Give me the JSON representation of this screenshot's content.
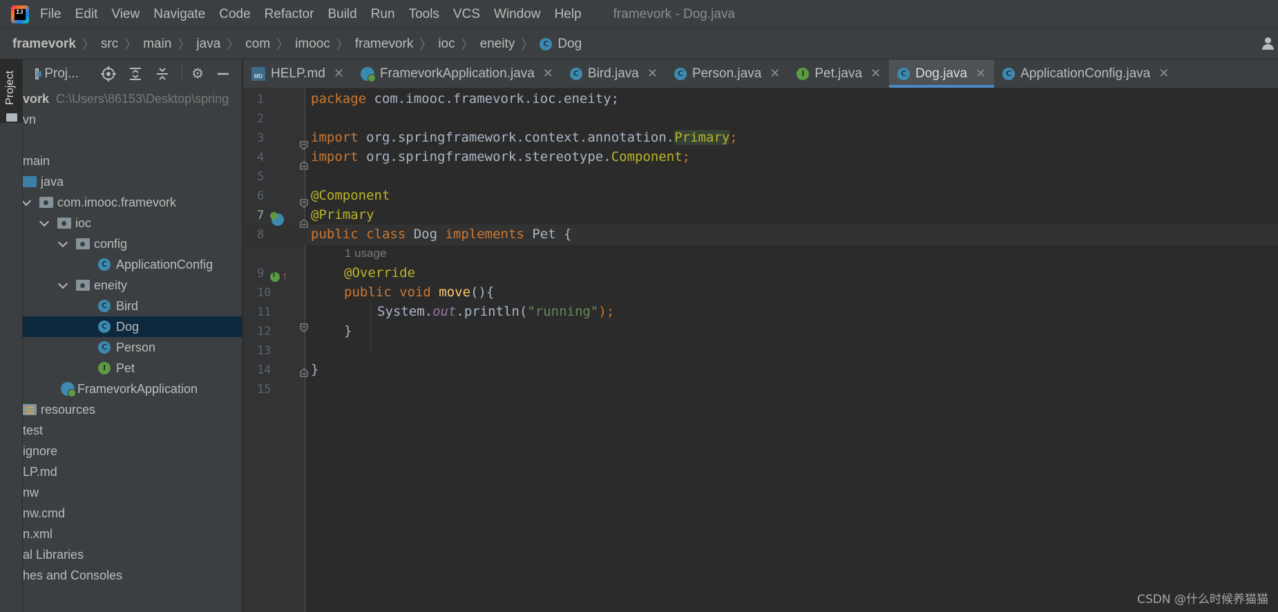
{
  "menubar": {
    "logo_text": "IJ",
    "items": [
      "File",
      "Edit",
      "View",
      "Navigate",
      "Code",
      "Refactor",
      "Build",
      "Run",
      "Tools",
      "VCS",
      "Window",
      "Help"
    ],
    "window_title": "framevork - Dog.java"
  },
  "breadcrumb": {
    "items": [
      "framevork",
      "src",
      "main",
      "java",
      "com",
      "imooc",
      "framevork",
      "ioc",
      "eneity",
      "Dog"
    ]
  },
  "tool_stripe": {
    "project_label": "Project"
  },
  "project_panel": {
    "title": "Proj...",
    "root_name": "vork",
    "root_path": "C:\\Users\\86153\\Desktop\\spring",
    "tree": [
      {
        "label": "vn"
      },
      {
        "label": ""
      },
      {
        "label": "main"
      },
      {
        "label": "java"
      },
      {
        "label": "com.imooc.framevork"
      },
      {
        "label": "ioc"
      },
      {
        "label": "config"
      },
      {
        "label": "ApplicationConfig"
      },
      {
        "label": "eneity"
      },
      {
        "label": "Bird"
      },
      {
        "label": "Dog"
      },
      {
        "label": "Person"
      },
      {
        "label": "Pet"
      },
      {
        "label": "FramevorkApplication"
      },
      {
        "label": "resources"
      },
      {
        "label": "test"
      },
      {
        "label": "ignore"
      },
      {
        "label": "LP.md"
      },
      {
        "label": "nw"
      },
      {
        "label": "nw.cmd"
      },
      {
        "label": "n.xml"
      },
      {
        "label": "al Libraries"
      },
      {
        "label": "hes and Consoles"
      }
    ]
  },
  "tabs": [
    {
      "label": "HELP.md",
      "icon": "markdown-icon"
    },
    {
      "label": "FramevorkApplication.java",
      "icon": "spring-app-icon"
    },
    {
      "label": "Bird.java",
      "icon": "class-icon"
    },
    {
      "label": "Person.java",
      "icon": "class-icon"
    },
    {
      "label": "Pet.java",
      "icon": "interface-icon"
    },
    {
      "label": "Dog.java",
      "icon": "class-icon",
      "active": true
    },
    {
      "label": "ApplicationConfig.java",
      "icon": "class-icon"
    }
  ],
  "editor": {
    "line_numbers": [
      "1",
      "2",
      "3",
      "4",
      "5",
      "6",
      "7",
      "8",
      "9",
      "10",
      "11",
      "12",
      "13",
      "14",
      "15"
    ],
    "current_line": "7",
    "usage_hint": "1 usage",
    "code": {
      "l1_kw": "package",
      "l1_rest": " com.imooc.framevork.ioc.eneity;",
      "l3_kw": "import",
      "l3_pkg": " org.springframework.context.annotation.",
      "l3_cls": "Primary",
      "l3_semi": ";",
      "l4_kw": "import",
      "l4_pkg": " org.springframework.stereotype.",
      "l4_cls": "Component",
      "l4_semi": ";",
      "l6_ann": "@Component",
      "l7_ann": "@Primary",
      "l8_kw1": "public class",
      "l8_name": " Dog ",
      "l8_kw2": "implements",
      "l8_rest": " Pet {",
      "l9_ann": "@Override",
      "l10_kw": "public void",
      "l10_fn": " move",
      "l10_rest": "(){",
      "l11_a": "System.",
      "l11_st": "out",
      "l11_b": ".println(",
      "l11_str": "\"running\"",
      "l11_c": ");",
      "l12": "}",
      "l14": "}"
    }
  },
  "watermark": "CSDN @什么时候养猫猫",
  "colors": {
    "accent": "#4a88c7",
    "keyword": "#cc7832",
    "annotation": "#bbb529",
    "string": "#6a8759",
    "selection": "#0d293e"
  }
}
